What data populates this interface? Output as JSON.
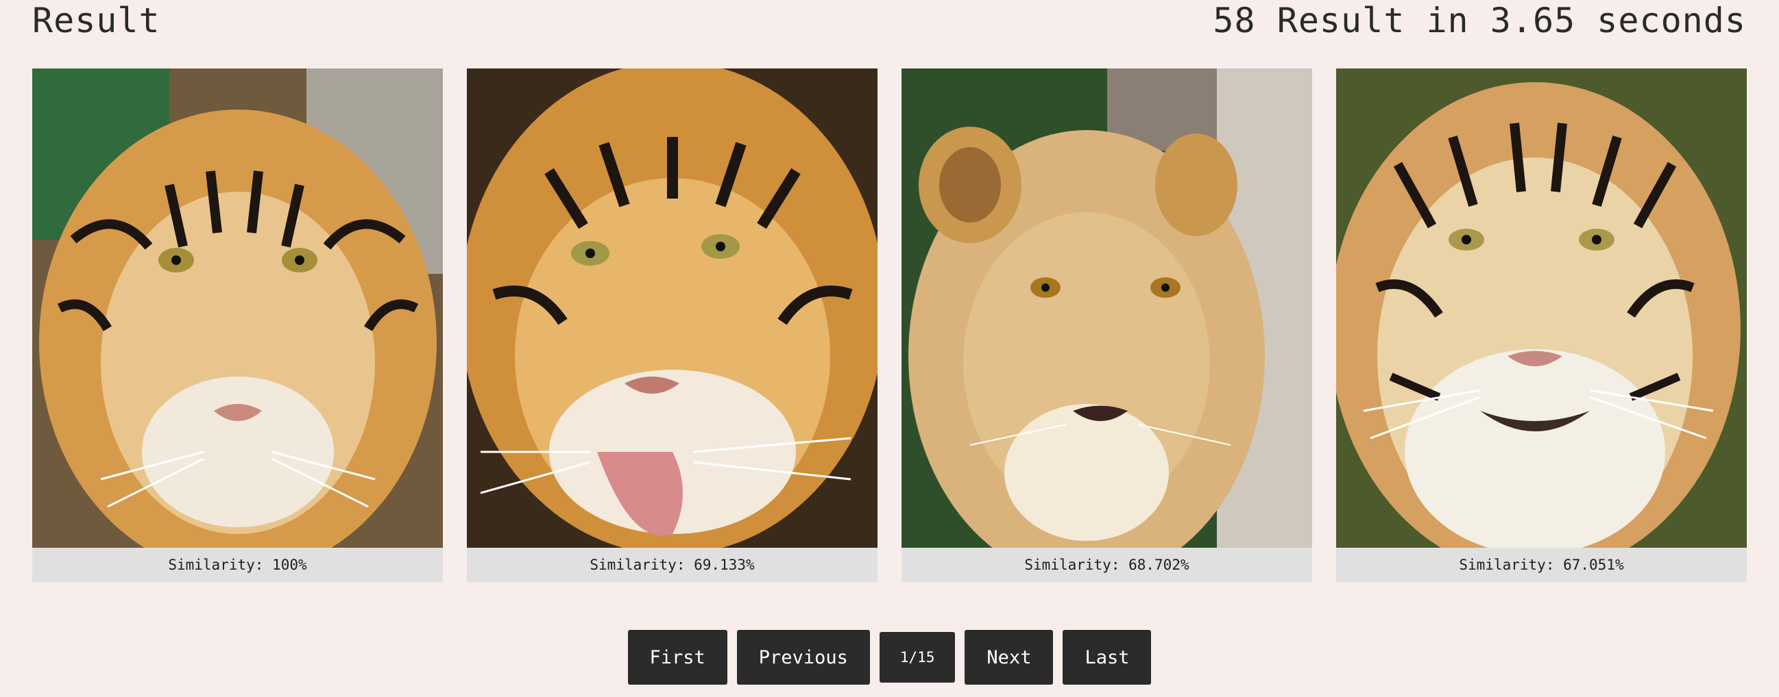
{
  "header": {
    "title": "Result",
    "summary": "58 Result in 3.65 seconds"
  },
  "results": [
    {
      "caption": "Similarity: 100%",
      "image_icon": "tiger-face-image",
      "animal": "tiger"
    },
    {
      "caption": "Similarity: 69.133%",
      "image_icon": "tiger-tongue-image",
      "animal": "tiger"
    },
    {
      "caption": "Similarity: 68.702%",
      "image_icon": "lioness-face-image",
      "animal": "lioness"
    },
    {
      "caption": "Similarity: 67.051%",
      "image_icon": "white-tiger-face-image",
      "animal": "tiger"
    }
  ],
  "pagination": {
    "first_label": "First",
    "previous_label": "Previous",
    "page_indicator": "1/15",
    "next_label": "Next",
    "last_label": "Last"
  },
  "colors": {
    "background": "#f7eeec",
    "caption_bar": "#e0e0e0",
    "button": "#2b2b2b",
    "button_text": "#ffffff"
  }
}
